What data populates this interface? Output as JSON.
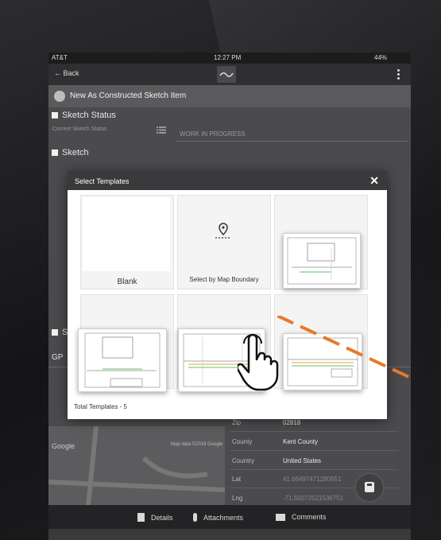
{
  "status_bar": {
    "carrier": "AT&T",
    "time": "12:27 PM",
    "battery": "44%"
  },
  "top_bar": {
    "back_label": "← Back"
  },
  "sub_header": {
    "title": "New As Constructed Sketch Item"
  },
  "sections": {
    "sketch_status": "Sketch Status",
    "current_sketch_status_label": "Current Sketch Status",
    "current_sketch_status_value": "WORK IN PROGRESS",
    "sketch": "Sketch",
    "s_partial": "S",
    "gp_partial": "GP"
  },
  "form": {
    "zip_label": "Zip",
    "zip_value": "02818",
    "county_label": "County",
    "county_value": "Kent County",
    "country_label": "Country",
    "country_value": "United States",
    "lat_label": "Lat",
    "lat_value": "41.66497471280551",
    "lng_label": "Lng",
    "lng_value": "-71.50072521536751"
  },
  "map": {
    "google": "Google",
    "credit": "Map data ©2018 Google"
  },
  "bottom_tabs": {
    "details": "Details",
    "attachments": "Attachments",
    "comments": "Comments"
  },
  "dialog": {
    "title": "Select Templates",
    "close": "✕",
    "templates": [
      {
        "label": "Blank"
      },
      {
        "label": "Select by Map Boundary"
      },
      {
        "label": ""
      },
      {
        "label": ""
      },
      {
        "label": ""
      },
      {
        "label": ""
      }
    ],
    "total_label": "Total Templates - 5"
  },
  "colors": {
    "accent_dash": "#e8792b",
    "dialog_header": "#3a3a3c"
  }
}
